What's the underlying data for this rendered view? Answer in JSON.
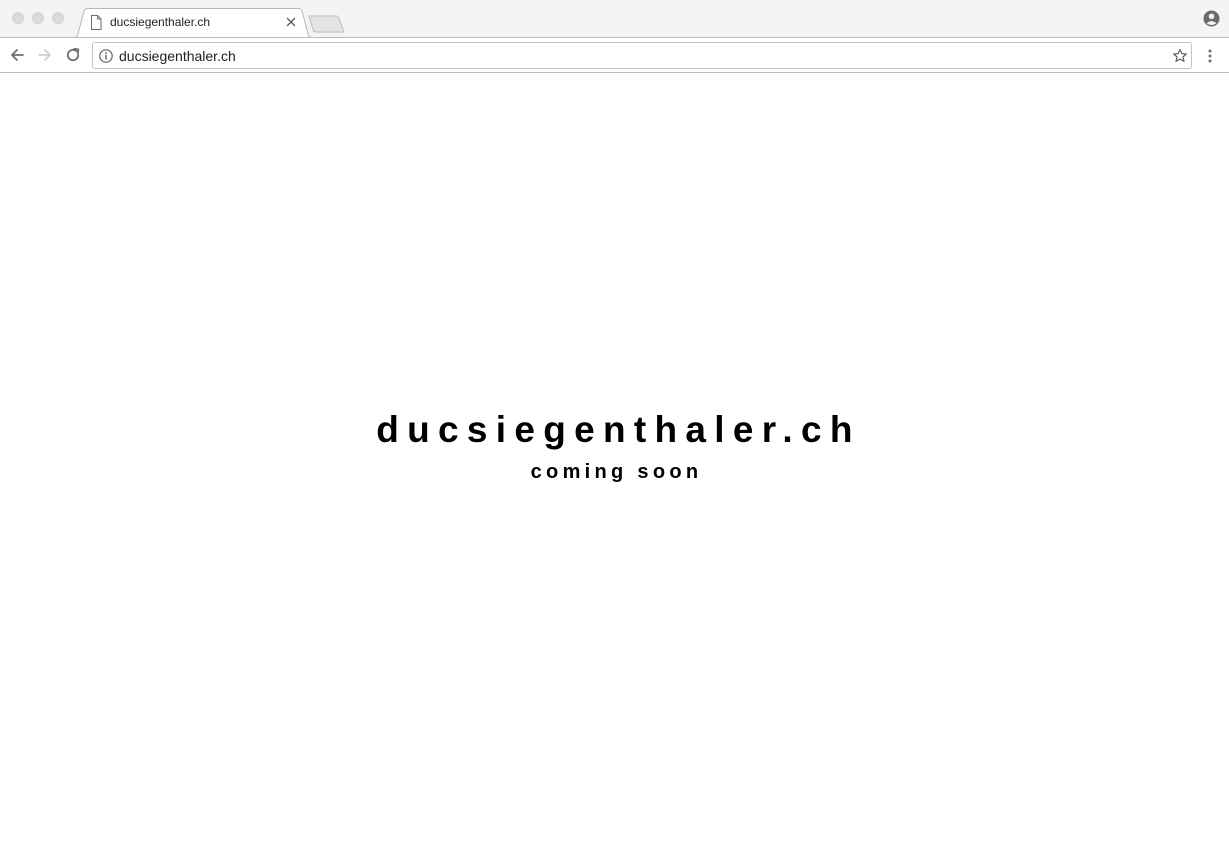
{
  "browser": {
    "tab": {
      "title": "ducsiegenthaler.ch"
    },
    "toolbar": {
      "url": "ducsiegenthaler.ch"
    }
  },
  "page": {
    "title": "ducsiegenthaler.ch",
    "subtitle": "coming soon"
  }
}
